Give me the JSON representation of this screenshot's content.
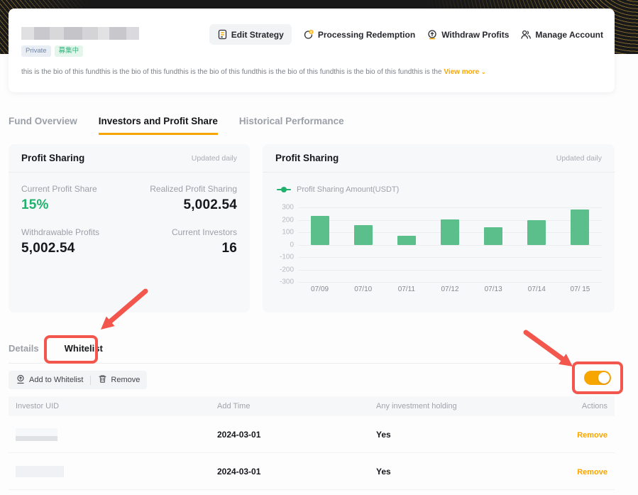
{
  "header": {
    "badges": {
      "private": "Private",
      "recruiting": "募集中"
    },
    "bio": "this is the bio of this fundthis is the bio of this fundthis is the bio of this fundthis is the bio of this fundthis is the bio of this fundthis is the ",
    "view_more": "View more",
    "actions": [
      {
        "label": "Edit Strategy",
        "icon": "document-icon"
      },
      {
        "label": "Processing Redemption",
        "icon": "refresh-gear-icon"
      },
      {
        "label": "Withdraw Profits",
        "icon": "coin-withdraw-icon"
      },
      {
        "label": "Manage Account",
        "icon": "people-icon"
      }
    ]
  },
  "tabs": {
    "items": [
      "Fund Overview",
      "Investors and Profit Share",
      "Historical Performance"
    ],
    "active": "Investors and Profit Share"
  },
  "profit_summary": {
    "title": "Profit Sharing",
    "updated": "Updated daily",
    "stats": [
      {
        "label": "Current Profit Share",
        "value": "15%"
      },
      {
        "label": "Realized Profit Sharing",
        "value": "5,002.54"
      },
      {
        "label": "Withdrawable Profits",
        "value": "5,002.54"
      },
      {
        "label": "Current Investors",
        "value": "16"
      }
    ]
  },
  "chart_card": {
    "title": "Profit Sharing",
    "updated": "Updated daily",
    "legend": "Profit Sharing Amount(USDT)"
  },
  "chart_data": {
    "type": "bar",
    "title": "Profit Sharing",
    "legend": [
      "Profit Sharing Amount(USDT)"
    ],
    "legend_position": "top-left",
    "categories": [
      "07/09",
      "07/10",
      "07/11",
      "07/12",
      "07/13",
      "07/14",
      "07/ 15"
    ],
    "values": [
      230,
      160,
      70,
      205,
      140,
      195,
      285
    ],
    "xlabel": "",
    "ylabel": "",
    "ylim": [
      -300,
      300
    ],
    "yticks": [
      300,
      200,
      100,
      0,
      -100,
      -200,
      -300
    ],
    "grid": true,
    "bar_color": "#5abf8b"
  },
  "sub_tabs": {
    "details": "Details",
    "whitelist": "Whitelist",
    "active": "Whitelist"
  },
  "toolbar": {
    "add_label": "Add to Whitelist",
    "remove_label": "Remove"
  },
  "whitelist_toggle": {
    "state": "on"
  },
  "table": {
    "columns": [
      "Investor UID",
      "Add Time",
      "Any investment holding",
      "Actions"
    ],
    "rows": [
      {
        "add_time": "2024-03-01",
        "holding": "Yes",
        "action": "Remove"
      },
      {
        "add_time": "2024-03-01",
        "holding": "Yes",
        "action": "Remove"
      }
    ]
  },
  "colors": {
    "accent_orange": "#f7a600",
    "green": "#20b26c",
    "bar_green": "#5abf8b",
    "annotation_red": "#f2564d",
    "dark_band": "#191919"
  }
}
